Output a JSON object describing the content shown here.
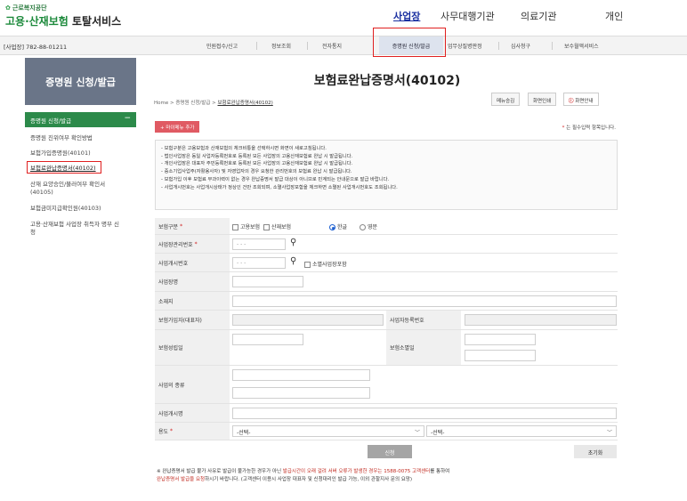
{
  "header": {
    "org_small": "근로복지공단",
    "title_green": "고용·산재보험",
    "title_black": " 토탈서비스",
    "nav": [
      "사업장",
      "사무대행기관",
      "의료기관",
      "개인"
    ]
  },
  "menubar": {
    "biz_number": "[사업장] 782-88-01211",
    "items": [
      "민원접수/신고",
      "정보조회",
      "전자통지",
      "증명원 신청/발급",
      "업무상질병판정",
      "심사청구",
      "보수월액서비스"
    ]
  },
  "sidebar": {
    "title": "증명원 신청/발급",
    "section": "증명원 신청/발급",
    "section_toggle": "−",
    "links": [
      "증명원 진위여부 확인방법",
      "보험가입증명원(40101)",
      "보험료완납증명서(40102)",
      "산재 요양승인/불러여부 확인서 (40105)",
      "보험금미지급확인원(40103)",
      "고용·산재보험 사업장 취득자 명부 신청"
    ]
  },
  "main": {
    "title": "보험료완납증명서(40102)",
    "breadcrumb": {
      "home": "Home",
      "sep1": " > ",
      "level1": "증명원 신청/발급",
      "sep2": " > ",
      "current": "보험료완납증명서(40102)"
    },
    "buttons": {
      "menu_save": "메뉴승김",
      "screen_print": "화면인쇄",
      "screen_help": "화면안내",
      "help_icon": "ⓘ"
    },
    "my_menu": "+ 마이메뉴 추가",
    "required_note": "는 필수입력 항목입니다.",
    "required_star": "*",
    "notice": [
      "- 보험구분은 고용보험과 산재보험의 체크비통을 선택하시면 화면이 새로고침됩니다.",
      "- 법인사업장은 동일 사업자등록번호로 등록된 모든 사업장의 고용산재보험료 완납 시 발급됩니다.",
      "- 개인사업장은 대표자 주민등록번호로 등록된 모든 사업장의 고용산재보험료 완납 시 발급됩니다.",
      "- 중소기업사업주(자활용사자) 및 자영업자의 경우 요청한 관리번호의 보험료 완납 시 발급됩니다.",
      "- 보험가입 이후 보험료 부과이력이 없는 경우 완납증명서 발급 대상이 아니므로 민계되는 안내문으로 발급 바랍니다.",
      "- 사업개시번호는 사업개시상태가 정상인 건만 조회되며, 소멸사업장포함을 체크하면 소멸된 사업개시번호도 조회됩니다."
    ],
    "form": {
      "insurance_type": {
        "label": "보험구분",
        "opt1": "고용보험",
        "opt2": "산재보험",
        "lang1": "한글",
        "lang2": "영문"
      },
      "mgmt_no": {
        "label": "사업장관리번호",
        "placeholder": "- - -"
      },
      "start_no": {
        "label": "사업개시번호",
        "placeholder": "- - -",
        "closed_opt": "소멸사업장포함"
      },
      "biz_name": {
        "label": "사업장명"
      },
      "address": {
        "label": "소재지"
      },
      "subscriber": {
        "label": "보험가입자(대표자)",
        "reg_label": "사업자등록번호"
      },
      "established": {
        "label": "보험성립일",
        "closed_label": "보험소멸일"
      },
      "biz_type": {
        "label": "사업의 종류"
      },
      "start_name": {
        "label": "사업개시명"
      },
      "purpose": {
        "label": "용도",
        "select1": "-선택-",
        "select2": "-선택-"
      }
    },
    "submit": "신청",
    "reset": "초기화",
    "footnote": {
      "line1_a": "※ 완납증명서 발급 불가 사유로 발급이 불가능한 경우가 아닌 ",
      "line1_red": "발급시간이 오래 걸려 서버 오류가 발생한 경우는 1588-0075 고객센터",
      "line1_b": "를 통하여",
      "line2_red": "완납증명서 발급을 요청",
      "line2_b": "하시기 바랍니다. (고객센터 이용시 사업장 대표자 및 신청대리인 발급 가능, 이외 관할지사 문의 요망)"
    }
  }
}
